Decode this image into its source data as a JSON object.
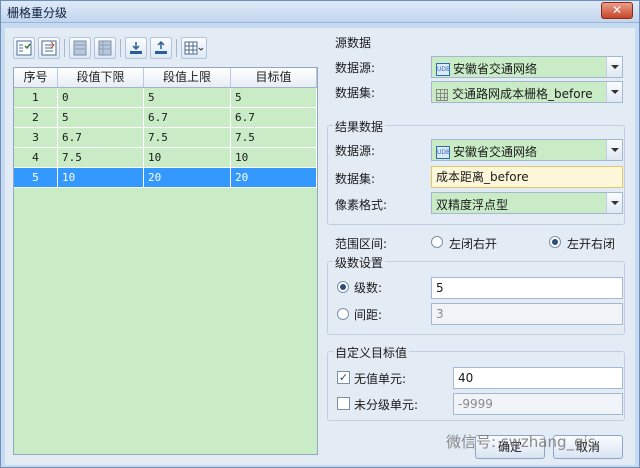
{
  "window": {
    "title": "栅格重分级",
    "close_symbol": "✕"
  },
  "toolbar": {
    "icons": [
      "select-all-icon",
      "invert-select-icon",
      "insert-row-icon",
      "delete-row-icon",
      "import-icon",
      "export-icon",
      "table-settings-icon"
    ]
  },
  "table": {
    "headers": [
      "序号",
      "段值下限",
      "段值上限",
      "目标值"
    ],
    "rows": [
      [
        "1",
        "0",
        "5",
        "5"
      ],
      [
        "2",
        "5",
        "6.7",
        "6.7"
      ],
      [
        "3",
        "6.7",
        "7.5",
        "7.5"
      ],
      [
        "4",
        "7.5",
        "10",
        "10"
      ],
      [
        "5",
        "10",
        "20",
        "20"
      ]
    ],
    "selected_row": 5
  },
  "source": {
    "title": "源数据",
    "datasource_label": "数据源:",
    "datasource_value": "安徽省交通网络",
    "dataset_label": "数据集:",
    "dataset_value": "交通路网成本栅格_before",
    "udb_badge": "UDB"
  },
  "result": {
    "title": "结果数据",
    "datasource_label": "数据源:",
    "datasource_value": "安徽省交通网络",
    "dataset_label": "数据集:",
    "dataset_value": "成本距离_before",
    "pixel_label": "像素格式:",
    "pixel_value": "双精度浮点型",
    "udb_badge": "UDB"
  },
  "range": {
    "label": "范围区间:",
    "option1": "左闭右开",
    "option2": "左开右闭",
    "selected": "option2"
  },
  "levels": {
    "title": "级数设置",
    "count_label": "级数:",
    "count_value": "5",
    "interval_label": "间距:",
    "interval_value": "3",
    "selected": "count"
  },
  "custom": {
    "title": "自定义目标值",
    "nodata_label": "无值单元:",
    "nodata_value": "40",
    "nodata_checked": true,
    "unclassified_label": "未分级单元:",
    "unclassified_value": "-9999",
    "unclassified_checked": false
  },
  "buttons": {
    "ok": "确定",
    "cancel": "取消"
  },
  "watermark": "微信号: swzhang_gis"
}
